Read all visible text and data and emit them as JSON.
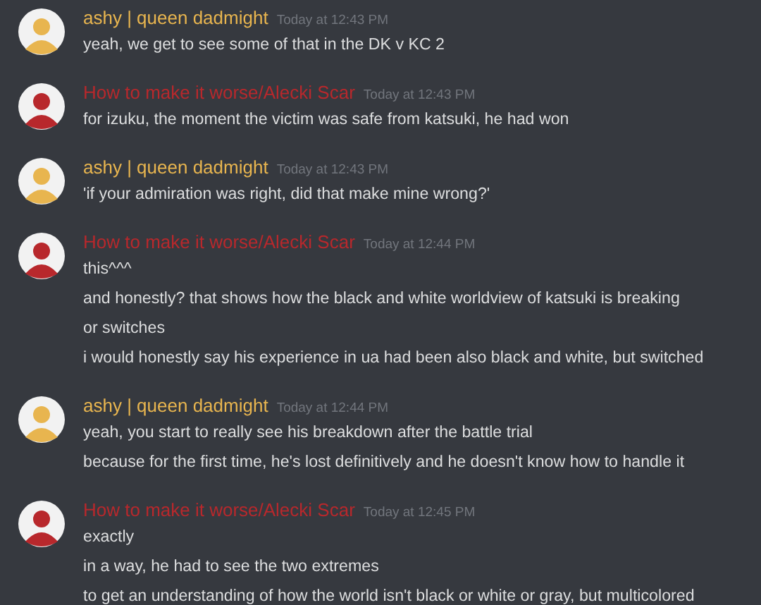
{
  "messages": [
    {
      "author": "ashy | queen dadmight",
      "color": "#e8b54f",
      "time": "Today at 12:43 PM",
      "lines": [
        "yeah, we get to see some of that in the DK v KC 2"
      ]
    },
    {
      "author": "How to make it worse/Alecki Scar",
      "color": "#b8282c",
      "time": "Today at 12:43 PM",
      "lines": [
        "for izuku, the moment the victim was safe from katsuki, he had won"
      ]
    },
    {
      "author": "ashy | queen dadmight",
      "color": "#e8b54f",
      "time": "Today at 12:43 PM",
      "lines": [
        "'if your admiration was right, did that make mine wrong?'"
      ]
    },
    {
      "author": "How to make it worse/Alecki Scar",
      "color": "#b8282c",
      "time": "Today at 12:44 PM",
      "lines": [
        "this^^^",
        "and honestly? that shows how the black and white worldview of katsuki is breaking",
        "or switches",
        "i would honestly say his experience in ua had been also black and white, but switched"
      ]
    },
    {
      "author": "ashy | queen dadmight",
      "color": "#e8b54f",
      "time": "Today at 12:44 PM",
      "lines": [
        "yeah, you start to really see his breakdown after the battle trial",
        "because for the first time, he's lost definitively and he doesn't know how to handle it"
      ]
    },
    {
      "author": "How to make it worse/Alecki Scar",
      "color": "#b8282c",
      "time": "Today at 12:45 PM",
      "lines": [
        "exactly",
        "in a way, he had to see the two extremes",
        "to get an understanding of how the world isn't black or white or gray, but multicolored"
      ]
    }
  ]
}
